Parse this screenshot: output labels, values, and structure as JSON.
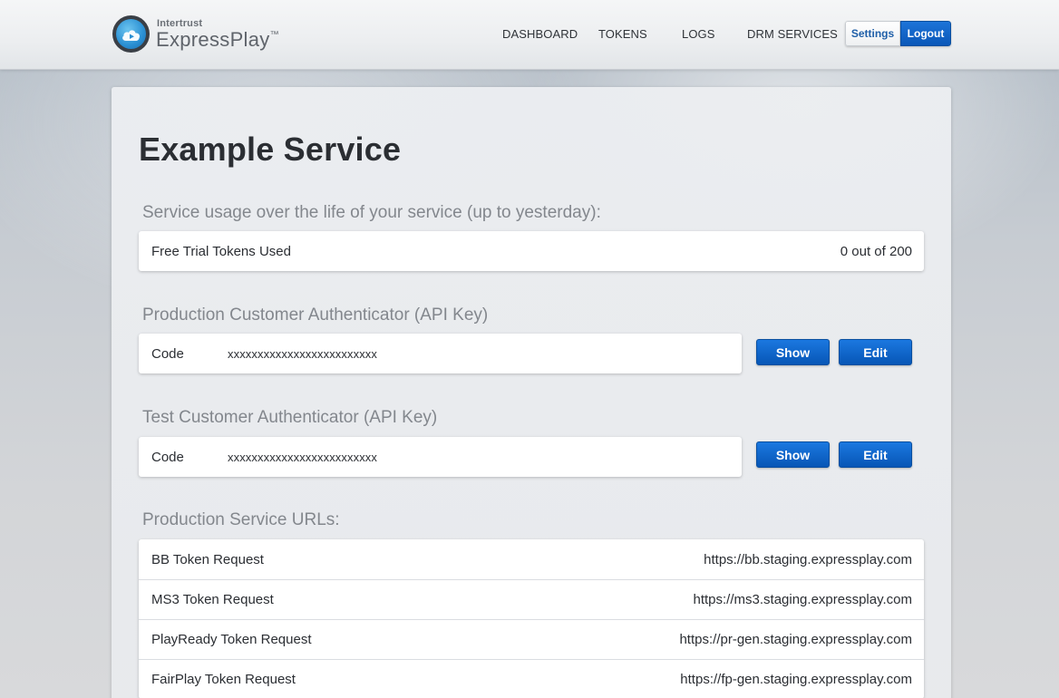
{
  "header": {
    "brand_small": "Intertrust",
    "brand_name": "ExpressPlay",
    "brand_tm": "™",
    "nav": [
      "DASHBOARD",
      "TOKENS",
      "LOGS",
      "DRM SERVICES"
    ],
    "settings_label": "Settings",
    "logout_label": "Logout"
  },
  "page": {
    "title": "Example Service"
  },
  "usage": {
    "heading": "Service usage over the life of your service (up to yesterday):",
    "label": "Free Trial Tokens Used",
    "value": "0 out of 200"
  },
  "prod_auth": {
    "heading": "Production Customer Authenticator (API Key)",
    "code_label": "Code",
    "code_value": "xxxxxxxxxxxxxxxxxxxxxxxxx",
    "show_label": "Show",
    "edit_label": "Edit"
  },
  "test_auth": {
    "heading": "Test Customer Authenticator (API Key)",
    "code_label": "Code",
    "code_value": "xxxxxxxxxxxxxxxxxxxxxxxxx",
    "show_label": "Show",
    "edit_label": "Edit"
  },
  "urls": {
    "heading": "Production Service URLs:",
    "rows": [
      {
        "label": "BB Token Request",
        "value": "https://bb.staging.expressplay.com"
      },
      {
        "label": "MS3 Token Request",
        "value": "https://ms3.staging.expressplay.com"
      },
      {
        "label": "PlayReady Token Request",
        "value": "https://pr-gen.staging.expressplay.com"
      },
      {
        "label": "FairPlay Token Request",
        "value": "https://fp-gen.staging.expressplay.com"
      }
    ]
  },
  "colors": {
    "accent": "#0a62c8",
    "title_text": "#2b2e33",
    "section_text": "#83878d"
  },
  "icons": {
    "logo": "play-cloud-icon"
  }
}
